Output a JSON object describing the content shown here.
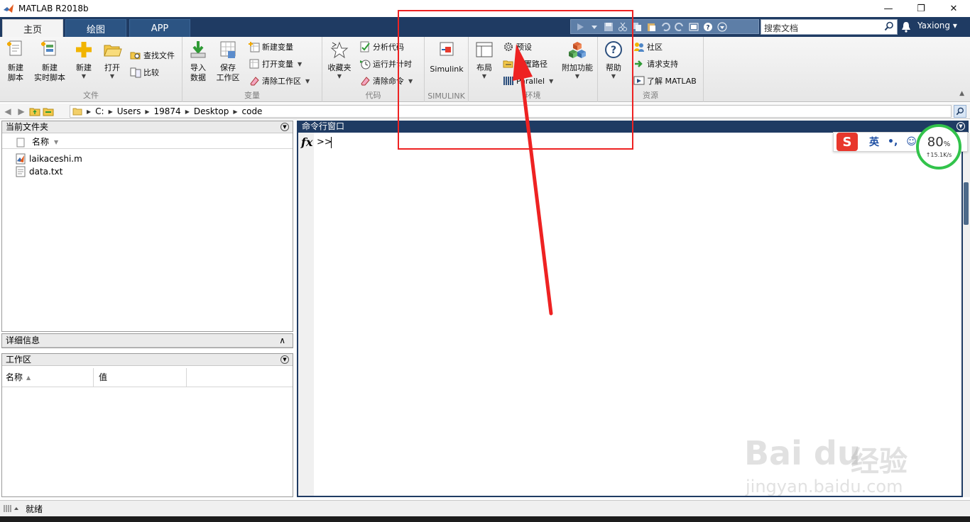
{
  "window": {
    "title": "MATLAB R2018b",
    "minimize": "—",
    "restore": "❐",
    "close": "✕"
  },
  "tabs": [
    {
      "label": "主页",
      "active": true
    },
    {
      "label": "绘图",
      "active": false
    },
    {
      "label": "APP",
      "active": false
    }
  ],
  "header": {
    "search_placeholder": "搜索文档",
    "user": "Yaxiong",
    "user_caret": "▾"
  },
  "ribbon": {
    "file": {
      "label": "文件",
      "new_script": "新建\n脚本",
      "new_live_script": "新建\n实时脚本",
      "new": "新建",
      "open": "打开",
      "find_files": "查找文件",
      "compare": "比较"
    },
    "variable": {
      "label": "变量",
      "import_data": "导入\n数据",
      "save_workspace": "保存\n工作区",
      "new_variable": "新建变量",
      "open_variable": "打开变量",
      "clear_workspace": "清除工作区"
    },
    "code": {
      "label": "代码",
      "favorites": "收藏夹",
      "analyze_code": "分析代码",
      "run_and_time": "运行并计时",
      "clear_commands": "清除命令"
    },
    "simulink": {
      "label": "SIMULINK",
      "simulink": "Simulink"
    },
    "environment": {
      "label": "环境",
      "layout": "布局",
      "preferences": "预设",
      "set_path": "设置路径",
      "parallel": "Parallel",
      "add_ons": "附加功能"
    },
    "resources": {
      "label": "资源",
      "help": "帮助",
      "community": "社区",
      "request_support": "请求支持",
      "learn_matlab": "了解 MATLAB"
    }
  },
  "address": {
    "segments": [
      "C:",
      "Users",
      "19874",
      "Desktop",
      "code"
    ]
  },
  "current_folder": {
    "title": "当前文件夹",
    "col_name": "名称",
    "files": [
      {
        "name": "laikaceshi.m",
        "icon": "matlab-file-icon"
      },
      {
        "name": "data.txt",
        "icon": "text-file-icon"
      }
    ]
  },
  "details": {
    "title": "详细信息",
    "toggle": "∧"
  },
  "workspace": {
    "title": "工作区",
    "col_name": "名称",
    "col_value": "值"
  },
  "command_window": {
    "title": "命令行窗口",
    "fx": "fx",
    "prompt": ">>"
  },
  "ime": {
    "logo": "S",
    "lang": "英",
    "punct": "•,",
    "emoji": "☺"
  },
  "net_monitor": {
    "percent": "80",
    "percent_unit": "%",
    "rate": "↑15.1K/s"
  },
  "status": {
    "text": "就绪"
  },
  "watermark": {
    "brand": "Bai du",
    "brand_cn": "经验",
    "url": "jingyan.baidu.com"
  },
  "colors": {
    "matlab_blue": "#1f3b63",
    "annotation_red": "#ee2222"
  }
}
